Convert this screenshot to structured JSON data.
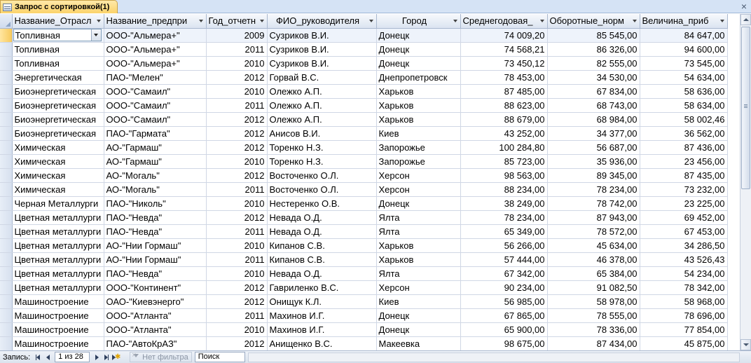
{
  "window": {
    "tab_title": "Запрос с сортировкой(1)"
  },
  "columns": [
    "Название_Отрасл",
    "Название_предпри",
    "Год_отчетн",
    "ФИО_руководителя",
    "Город",
    "Среднегодовая_",
    "Оборотные_норм",
    "Величина_приб"
  ],
  "rows": [
    [
      "Топливная",
      "ООО-\"Альмера+\"",
      "2009",
      "Сузриков В.И.",
      "Донецк",
      "74 009,20",
      "85 545,00",
      "84 647,00"
    ],
    [
      "Топливная",
      "ООО-\"Альмера+\"",
      "2011",
      "Сузриков В.И.",
      "Донецк",
      "74 568,21",
      "86 326,00",
      "94 600,00"
    ],
    [
      "Топливная",
      "ООО-\"Альмера+\"",
      "2010",
      "Сузриков В.И.",
      "Донецк",
      "73 450,12",
      "82 555,00",
      "73 545,00"
    ],
    [
      "Энергетическая",
      "ПАО-\"Мелен\"",
      "2012",
      "Горвай В.С.",
      "Днепропетровск",
      "78 453,00",
      "34 530,00",
      "54 634,00"
    ],
    [
      "Биоэнергетическая",
      "ООО-\"Самаил\"",
      "2010",
      "Олежко А.П.",
      "Харьков",
      "87 485,00",
      "67 834,00",
      "58 636,00"
    ],
    [
      "Биоэнергетическая",
      "ООО-\"Самаил\"",
      "2011",
      "Олежко А.П.",
      "Харьков",
      "88 623,00",
      "68 743,00",
      "58 634,00"
    ],
    [
      "Биоэнергетическая",
      "ООО-\"Самаил\"",
      "2012",
      "Олежко А.П.",
      "Харьков",
      "88 679,00",
      "68 984,00",
      "58 002,46"
    ],
    [
      "Биоэнергетическая",
      "ПАО-\"Гармата\"",
      "2012",
      "Анисов В.И.",
      "Киев",
      "43 252,00",
      "34 377,00",
      "36 562,00"
    ],
    [
      "Химическая",
      "АО-\"Гармаш\"",
      "2012",
      "Торенко Н.З.",
      "Запорожье",
      "100 284,80",
      "56 687,00",
      "87 436,00"
    ],
    [
      "Химическая",
      "АО-\"Гармаш\"",
      "2010",
      "Торенко Н.З.",
      "Запорожье",
      "85 723,00",
      "35 936,00",
      "23 456,00"
    ],
    [
      "Химическая",
      "АО-\"Могаль\"",
      "2012",
      "Восточенко О.Л.",
      "Херсон",
      "98 563,00",
      "89 345,00",
      "87 435,00"
    ],
    [
      "Химическая",
      "АО-\"Могаль\"",
      "2011",
      "Восточенко О.Л.",
      "Херсон",
      "88 234,00",
      "78 234,00",
      "73 232,00"
    ],
    [
      "Черная Металлурги",
      "ПАО-\"Николь\"",
      "2010",
      "Нестеренко О.В.",
      "Донецк",
      "38 249,00",
      "78 742,00",
      "23 225,00"
    ],
    [
      "Цветная металлурги",
      "ПАО-\"Невда\"",
      "2012",
      "Невада О.Д.",
      "Ялта",
      "78 234,00",
      "87 943,00",
      "69 452,00"
    ],
    [
      "Цветная металлурги",
      "ПАО-\"Невда\"",
      "2011",
      "Невада О.Д.",
      "Ялта",
      "65 349,00",
      "78 572,00",
      "67 453,00"
    ],
    [
      "Цветная металлурги",
      "АО-\"Нии Гормаш\"",
      "2010",
      "Кипанов С.В.",
      "Харьков",
      "56 266,00",
      "45 634,00",
      "34 286,50"
    ],
    [
      "Цветная металлурги",
      "АО-\"Нии Гормаш\"",
      "2011",
      "Кипанов С.В.",
      "Харьков",
      "57 444,00",
      "46 378,00",
      "43 526,43"
    ],
    [
      "Цветная металлурги",
      "ПАО-\"Невда\"",
      "2010",
      "Невада О.Д.",
      "Ялта",
      "67 342,00",
      "65 384,00",
      "54 234,00"
    ],
    [
      "Цветная металлурги",
      "ООО-\"Континент\"",
      "2012",
      "Гавриленко В.С.",
      "Херсон",
      "90 234,00",
      "91 082,50",
      "78 342,00"
    ],
    [
      "Машиностроение",
      "ОАО-\"Киевэнерго\"",
      "2012",
      "Онищук К.Л.",
      "Киев",
      "56 985,00",
      "58 978,00",
      "58 968,00"
    ],
    [
      "Машиностроение",
      "ООО-\"Атланта\"",
      "2011",
      "Махинов И.Г.",
      "Донецк",
      "67 865,00",
      "78 555,00",
      "78 696,00"
    ],
    [
      "Машиностроение",
      "ООО-\"Атланта\"",
      "2010",
      "Махинов И.Г.",
      "Донецк",
      "65 900,00",
      "78 336,00",
      "77 854,00"
    ],
    [
      "Машиностроение",
      "ПАО-\"АвтоКрАЗ\"",
      "2012",
      "Анищенко В.С.",
      "Макеевка",
      "98 675,00",
      "87 434,00",
      "45 875,00"
    ]
  ],
  "current_row": 0,
  "navigation": {
    "label": "Запись:",
    "position": "1 из 28",
    "filter": "Нет фильтра",
    "search": "Поиск"
  }
}
